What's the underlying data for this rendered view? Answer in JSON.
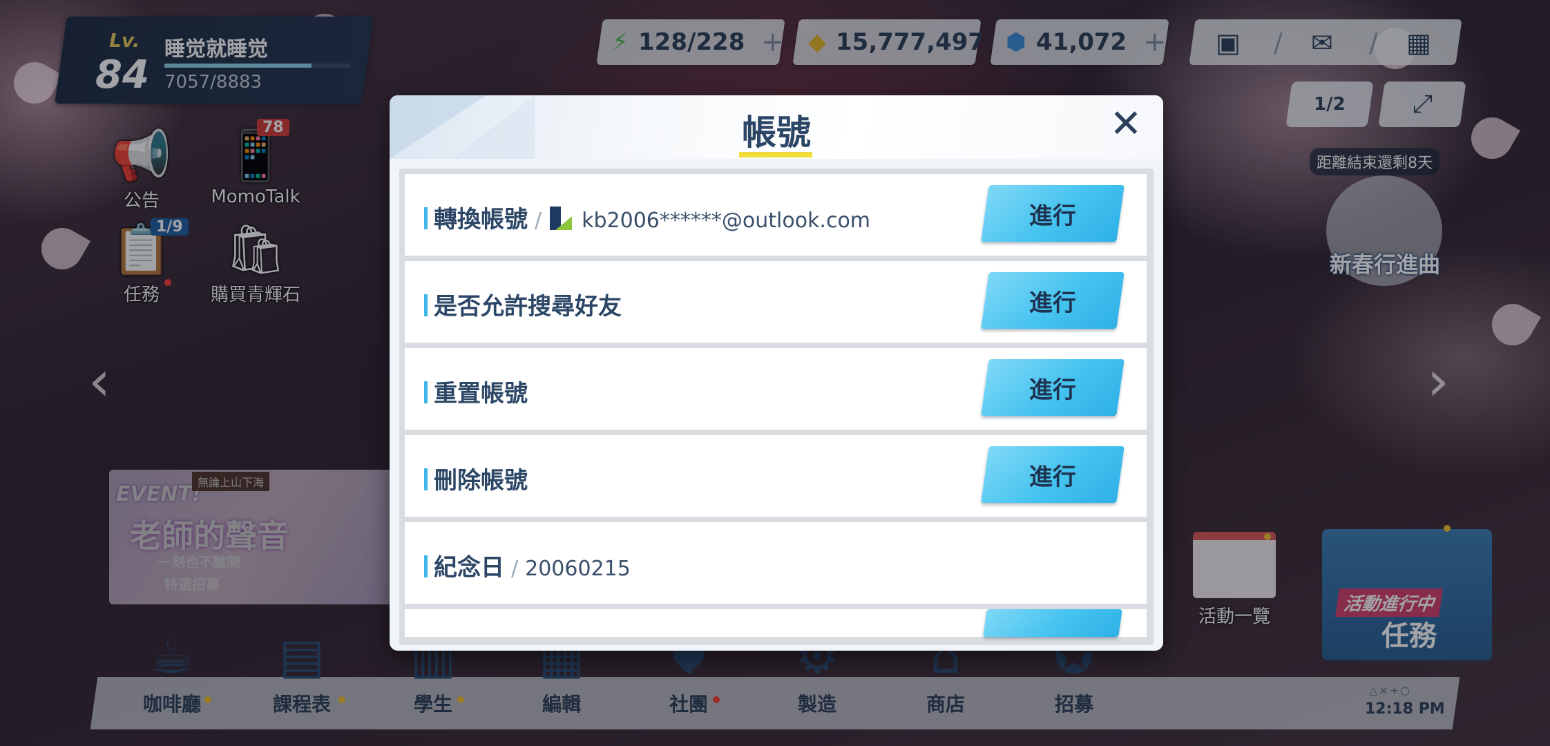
{
  "player": {
    "level_label": "Lv.",
    "level": "84",
    "name": "睡觉就睡觉",
    "exp_text": "7057/8883",
    "exp_fraction": 0.79
  },
  "resources": {
    "ap": "128/228",
    "credits": "15,777,497",
    "pyroxene": "41,072"
  },
  "top_icons": [
    "friends-icon",
    "mail-icon",
    "menu-grid-icon"
  ],
  "page_indicator": "1/2",
  "side_menu": {
    "notice": "公告",
    "momotalk": "MomoTalk",
    "momotalk_badge": "78",
    "tasks": "任務",
    "tasks_badge": "1/9",
    "buy_pyroxene": "購買青輝石"
  },
  "event_banner": {
    "tag": "EVENT!",
    "subtitle": "無論上山下海",
    "title": "老師的聲音",
    "line2": "一刻也不離開",
    "line3": "特選招募"
  },
  "right_panel": {
    "countdown": "距離結束還剩8天",
    "event_name": "新春行進曲",
    "events_list": "活動一覽",
    "mission_tag": "活動進行中",
    "mission_label": "任務"
  },
  "bottom_nav": [
    {
      "label": "咖啡廳",
      "icon": "cafe-icon"
    },
    {
      "label": "課程表",
      "icon": "schedule-icon"
    },
    {
      "label": "學生",
      "icon": "students-icon"
    },
    {
      "label": "編輯",
      "icon": "formation-icon"
    },
    {
      "label": "社團",
      "icon": "club-icon"
    },
    {
      "label": "製造",
      "icon": "craft-icon"
    },
    {
      "label": "商店",
      "icon": "shop-icon"
    },
    {
      "label": "招募",
      "icon": "recruit-icon"
    }
  ],
  "clock": {
    "time": "12:18 PM",
    "symbols": "△×+○"
  },
  "modal": {
    "title": "帳號",
    "rows": [
      {
        "label": "轉換帳號",
        "value": "kb2006******@outlook.com",
        "button": "進行"
      },
      {
        "label": "是否允許搜尋好友",
        "button": "進行"
      },
      {
        "label": "重置帳號",
        "button": "進行"
      },
      {
        "label": "刪除帳號",
        "button": "進行"
      },
      {
        "label": "紀念日",
        "value": "20060215"
      }
    ]
  },
  "colors": {
    "accent": "#45c3f0",
    "title": "#2c4666",
    "underline": "#f2dc3c"
  }
}
